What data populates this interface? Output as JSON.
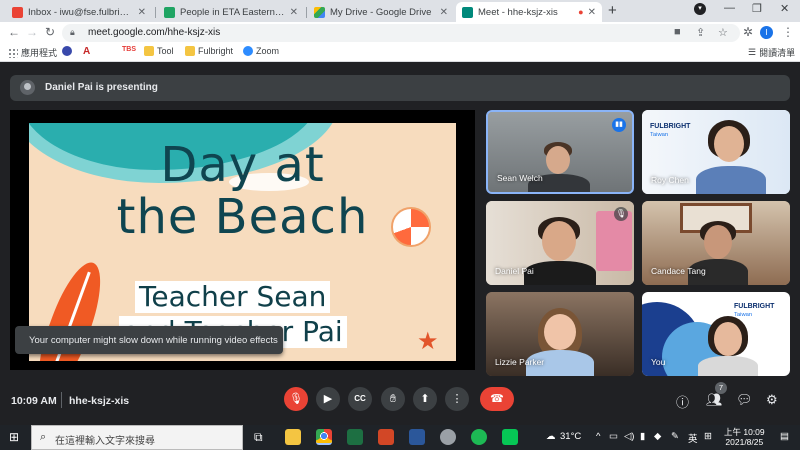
{
  "browser": {
    "tabs": [
      {
        "title": "Inbox - iwu@fse.fulbright.org.t",
        "favicon": "gmail-icon",
        "color": "#ea4335",
        "active": false
      },
      {
        "title": "People in ETA Eastern Region",
        "favicon": "sheets-icon",
        "color": "#1fa463",
        "active": false
      },
      {
        "title": "My Drive - Google Drive",
        "favicon": "drive-icon",
        "color": "#fbbc04",
        "active": false
      },
      {
        "title": "Meet - hhe-ksjz-xis",
        "favicon": "meet-icon",
        "color": "#00897b",
        "active": true
      }
    ],
    "address": "meet.google.com/hhe-ksjz-xis",
    "profile_initial": "I",
    "bookmarks": [
      {
        "label": "應用程式",
        "icon": "apps-grid-icon",
        "color": "#5f6368"
      },
      {
        "label": "",
        "icon": "globe-icon",
        "color": "#3949ab"
      },
      {
        "label": "",
        "icon": "a-icon",
        "color": "#c62828"
      },
      {
        "label": "",
        "icon": "tbs-icon",
        "color": "#e53935"
      },
      {
        "label": "Tool",
        "icon": "folder-icon",
        "color": "#f4c542"
      },
      {
        "label": "Fulbright",
        "icon": "folder-icon",
        "color": "#f4c542"
      },
      {
        "label": "Zoom",
        "icon": "zoom-icon",
        "color": "#2d8cff"
      }
    ],
    "reading_list": "閱讀清單"
  },
  "meet": {
    "presenting_banner": "Daniel Pai is presenting",
    "slide": {
      "title_line1": "Day at",
      "title_line2": "the Beach",
      "subtitle_line1": "Teacher Sean",
      "subtitle_line2": "and Teacher Pai"
    },
    "toast": "Your computer might slow down while running video effects",
    "participants": [
      {
        "name": "Sean Welch",
        "muted": false,
        "speaking": true
      },
      {
        "name": "Roy Chen",
        "muted": false,
        "brand": "FULBRIGHT",
        "brand_sub": "Taiwan"
      },
      {
        "name": "Daniel Pai",
        "muted": true
      },
      {
        "name": "Candace Tang",
        "muted": false
      },
      {
        "name": "Lizzie Parker",
        "muted": false
      },
      {
        "name": "You",
        "muted": false,
        "brand": "FULBRIGHT",
        "brand_sub": "Taiwan"
      }
    ],
    "time": "10:09 AM",
    "meeting_code": "hhe-ksjz-xis",
    "people_count": "7",
    "colors": {
      "red": "#ea4335",
      "control_bg": "#3c4043",
      "accent": "#1a73e8"
    }
  },
  "taskbar": {
    "search_placeholder": "在這裡輸入文字來搜尋",
    "weather": "31°C",
    "ime": "英",
    "clock_time": "上午 10:09",
    "clock_date": "2021/8/25"
  }
}
